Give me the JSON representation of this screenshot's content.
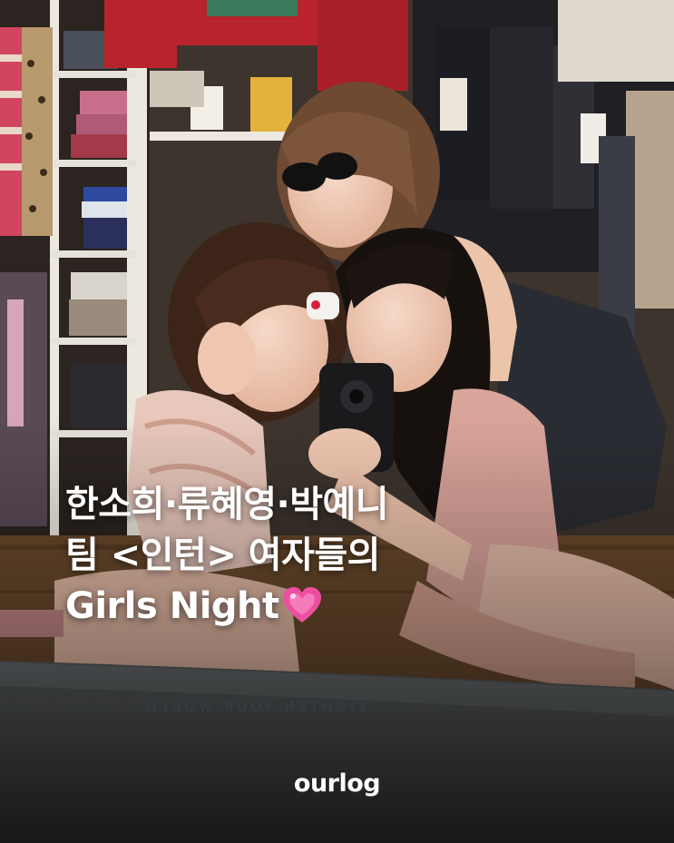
{
  "photo": {
    "scene": "closet-mirror-selfie",
    "colors": {
      "floor": "#6b4a2c",
      "shelf": "#ece8e0",
      "leather": "#1c1d22",
      "pink_dress": "#d9a49a",
      "red_garment": "#b8232c"
    }
  },
  "headline": {
    "line1": "한소희·류혜영·박예니",
    "line2": "팀 <인턴> 여자들의",
    "line3": "Girls Night",
    "emoji": "sparkling-heart-icon",
    "emoji_color": "#ec4fa0"
  },
  "mirror_text": "LIGHTEN YOUR WORLD",
  "brand": {
    "logo": "ourlog"
  }
}
